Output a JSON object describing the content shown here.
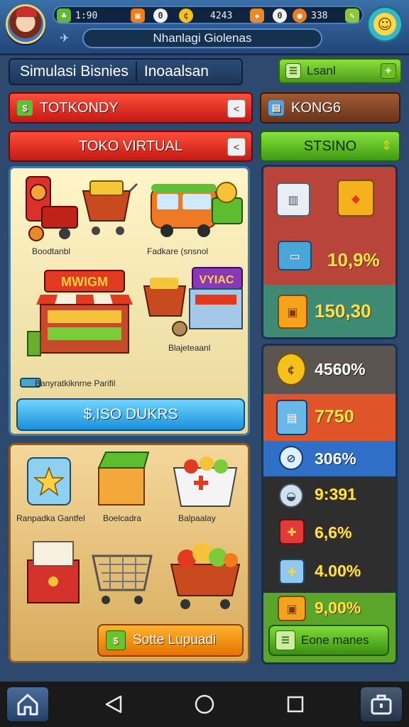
{
  "hud": {
    "resources": [
      {
        "icon": "clover-icon",
        "value": "1:90",
        "color": "#5fb83a"
      },
      {
        "icon": "gift-icon",
        "value": "",
        "color": "#f07c1c"
      },
      {
        "icon": "egg-icon",
        "value": "",
        "color": "#f2f2f2"
      },
      {
        "icon": "coin-icon",
        "value": "4243",
        "color": "#f5c21c"
      },
      {
        "icon": "tag-icon",
        "value": "",
        "color": "#e88a2a"
      },
      {
        "icon": "egg-icon",
        "value": "",
        "color": "#f2f2f2"
      },
      {
        "icon": "orange-icon",
        "value": "338",
        "color": "#f07c1c"
      },
      {
        "icon": "wand-icon",
        "value": "",
        "color": "#8cc63f"
      }
    ],
    "player_name": "Nhanlagi Giolenas"
  },
  "title": {
    "part1": "Simulasi Bisnies",
    "part2": "Inoaalsan"
  },
  "lsanl_button": "Lsanl",
  "buttons": {
    "totkondy": "TOTKONDY",
    "kong6": "KONG6",
    "toko_virtual": "TOKO VIRTUAL",
    "stsino": "STSINO"
  },
  "shop": {
    "items": [
      {
        "label": "Boodtanbl"
      },
      {
        "label": "Fadkare (snsnol"
      },
      {
        "label": "Blajeteaanl"
      },
      {
        "label": "Banyratkiknrne Parifil"
      }
    ],
    "cta": "$,ISO DUKRS"
  },
  "storage": {
    "items": [
      {
        "label": "Ranpadka Gantfel"
      },
      {
        "label": "Boelcadra"
      },
      {
        "label": "Balpaalay"
      }
    ],
    "cta": "Sotte Lupuadi"
  },
  "stats": {
    "top": [
      {
        "icon": "box-icon",
        "value": ""
      },
      {
        "icon": "box-icon",
        "value": ""
      },
      {
        "icon": "box-icon",
        "value": "10,9%"
      },
      {
        "icon": "box-icon",
        "value": "150,30"
      }
    ],
    "bottom": [
      {
        "icon": "coins-icon",
        "value": "4560%",
        "bg": "#5a5550"
      },
      {
        "icon": "card-icon",
        "value": "7750",
        "bg": "#e0542a"
      },
      {
        "icon": "compass-icon",
        "value": "306%",
        "bg": "#2f6fc8"
      },
      {
        "icon": "kettle-icon",
        "value": "9:391",
        "bg": "#2e2e2e"
      },
      {
        "icon": "gift-box-icon",
        "value": "6,6%",
        "bg": "#2e2e2e"
      },
      {
        "icon": "gift-box-icon",
        "value": "4.00%",
        "bg": "#2e2e2e"
      },
      {
        "icon": "chest-icon",
        "value": "9,00%",
        "bg": "#5aa52a"
      }
    ],
    "cta": "Eone manes"
  }
}
